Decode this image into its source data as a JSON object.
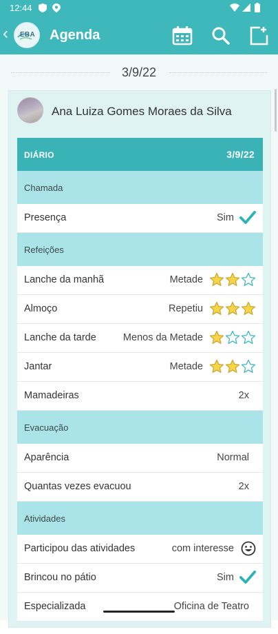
{
  "status_bar": {
    "time": "12:44"
  },
  "app_bar": {
    "title": "Agenda",
    "logo_text": "EBA"
  },
  "date_separator": "3/9/22",
  "student": {
    "name": "Ana Luiza Gomes Moraes da Silva"
  },
  "diario": {
    "label": "DIÁRIO",
    "date": "3/9/22",
    "sections": [
      {
        "title": "Chamada"
      },
      {
        "title": "Refeições"
      },
      {
        "title": "Evacuação"
      },
      {
        "title": "Atividades"
      }
    ],
    "rows": [
      {
        "label": "Presença",
        "value": "Sim",
        "icon": "check-icon"
      },
      {
        "label": "Lanche da manhã",
        "value": "Metade",
        "stars": 2
      },
      {
        "label": "Almoço",
        "value": "Repetiu",
        "stars": 3
      },
      {
        "label": "Lanche da tarde",
        "value": "Menos da Metade",
        "stars": 1
      },
      {
        "label": "Jantar",
        "value": "Metade",
        "stars": 2
      },
      {
        "label": "Mamadeiras",
        "value": "2x"
      },
      {
        "label": "Aparência",
        "value": "Normal"
      },
      {
        "label": "Quantas vezes evacuou",
        "value": "2x"
      },
      {
        "label": "Participou das atividades",
        "value": "com interesse",
        "icon": "smiley-icon"
      },
      {
        "label": "Brincou no pátio",
        "value": "Sim",
        "icon": "check-icon"
      },
      {
        "label": "Especializada",
        "value": "Oficina de Teatro"
      }
    ],
    "stars_max": 3
  },
  "colors": {
    "primary": "#3fb8bb",
    "header": "#39b3b5",
    "section": "#aae4e8",
    "star_fill": "#f6d548",
    "star_empty": "#3fb8bb",
    "check": "#2fb3b5"
  }
}
